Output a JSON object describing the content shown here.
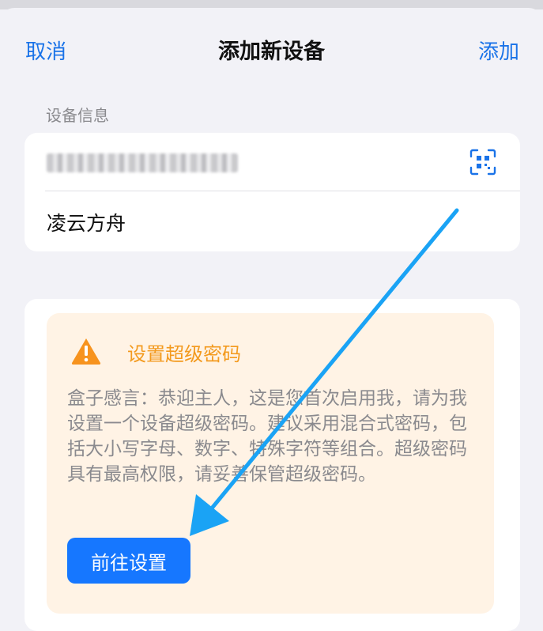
{
  "nav": {
    "cancel": "取消",
    "title": "添加新设备",
    "add": "添加"
  },
  "device_info": {
    "section_label": "设备信息",
    "serial_value": "",
    "scan_icon": "qr-scan-icon",
    "device_name": "凌云方舟"
  },
  "password_notice": {
    "icon": "warning-triangle-icon",
    "title": "设置超级密码",
    "body": "盒子感言：恭迎主人，这是您首次启用我，请为我设置一个设备超级密码。建议采用混合式密码，包括大小写字母、数字、特殊字符等组合。超级密码具有最高权限，请妥善保管超级密码。",
    "button": "前往设置"
  },
  "colors": {
    "accent": "#1a73e8",
    "warning": "#f39a1e",
    "button": "#1677ff",
    "annotation_arrow": "#1aa3f5"
  }
}
